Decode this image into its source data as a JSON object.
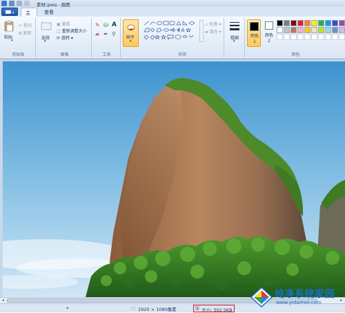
{
  "window": {
    "title": "素材.jpeg - 画图"
  },
  "tabs": [
    {
      "label": "主页"
    },
    {
      "label": "查看"
    }
  ],
  "ribbon": {
    "clipboard": {
      "paste": "粘贴",
      "cut": "剪切",
      "copy": "复制",
      "group_label": "剪贴板"
    },
    "image": {
      "select": "选择",
      "crop": "裁剪",
      "resize": "重新调整大小",
      "rotate": "旋转",
      "group_label": "图像"
    },
    "tools": {
      "group_label": "工具"
    },
    "brushes": {
      "label": "刷子"
    },
    "shapes": {
      "outline": "轮廓",
      "fill": "填充",
      "group_label": "形状"
    },
    "size": {
      "label": "粗细"
    },
    "colors": {
      "color1_label": "颜色 1",
      "color2_label": "颜色 2",
      "group_label": "颜色",
      "color1_value": "#000000",
      "color2_value": "#ffffff",
      "palette_row1": [
        "#000000",
        "#7f7f7f",
        "#880015",
        "#ed1c24",
        "#ff7f27",
        "#fff200",
        "#22b14c",
        "#00a2e8",
        "#3f48cc",
        "#a349a4"
      ],
      "palette_row2": [
        "#ffffff",
        "#c3c3c3",
        "#b97a57",
        "#ffaec9",
        "#ffc90e",
        "#efe4b0",
        "#b5e61d",
        "#99d9ea",
        "#7092be",
        "#c8bfe7"
      ]
    }
  },
  "status": {
    "dimensions": "1920 × 1080像素",
    "file_size": "大小: 302.5KB"
  },
  "watermark": {
    "title": "纯净系统家园",
    "url": "www.yidaimei.com"
  }
}
